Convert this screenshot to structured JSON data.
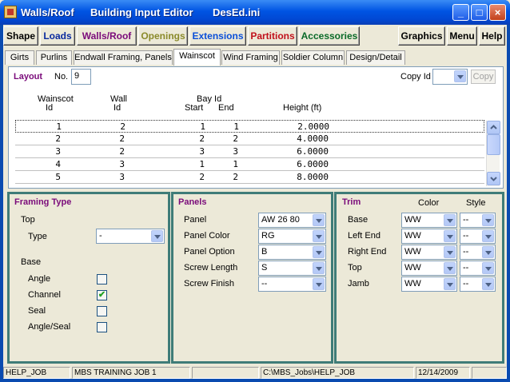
{
  "window": {
    "app_title": "Walls/Roof",
    "subtitle": "Building Input Editor",
    "file": "DesEd.ini",
    "controls": {
      "minimize": "_",
      "maximize": "□",
      "close": "×"
    }
  },
  "menu": {
    "left": [
      {
        "label": "Shape",
        "color": "#000000"
      },
      {
        "label": "Loads",
        "color": "#0a2a9e"
      },
      {
        "label": "Walls/Roof",
        "color": "#7a0a7a"
      },
      {
        "label": "Openings",
        "color": "#8a8a2a"
      },
      {
        "label": "Extensions",
        "color": "#0a4fd8"
      },
      {
        "label": "Partitions",
        "color": "#c0101a"
      },
      {
        "label": "Accessories",
        "color": "#0a6a28"
      }
    ],
    "right": [
      {
        "label": "Graphics"
      },
      {
        "label": "Menu"
      },
      {
        "label": "Help"
      }
    ]
  },
  "tabs": [
    "Girts",
    "Purlins",
    "Endwall Framing, Panels",
    "Wainscot",
    "Wind Framing",
    "Soldier Column",
    "Design/Detail"
  ],
  "active_tab": "Wainscot",
  "layout": {
    "title": "Layout",
    "no_label": "No.",
    "no_value": "9",
    "copy_id_label": "Copy Id",
    "copy_id_value": "",
    "copy_button": "Copy",
    "headers": {
      "wainscot": [
        "Wainscot",
        "Id"
      ],
      "wall": [
        "Wall",
        "Id"
      ],
      "bay": "Bay Id",
      "start": "Start",
      "end": "End",
      "height": "Height (ft)"
    },
    "rows": [
      {
        "id": "1",
        "wall": "2",
        "start": "1",
        "end": "1",
        "height": "2.0000"
      },
      {
        "id": "2",
        "wall": "2",
        "start": "2",
        "end": "2",
        "height": "4.0000"
      },
      {
        "id": "3",
        "wall": "2",
        "start": "3",
        "end": "3",
        "height": "6.0000"
      },
      {
        "id": "4",
        "wall": "3",
        "start": "1",
        "end": "1",
        "height": "6.0000"
      },
      {
        "id": "5",
        "wall": "3",
        "start": "2",
        "end": "2",
        "height": "8.0000"
      }
    ]
  },
  "framing": {
    "title": "Framing Type",
    "top_label": "Top",
    "type_label": "Type",
    "type_value": "-",
    "base_label": "Base",
    "options": [
      {
        "label": "Angle",
        "checked": false
      },
      {
        "label": "Channel",
        "checked": true
      },
      {
        "label": "Seal",
        "checked": false
      },
      {
        "label": "Angle/Seal",
        "checked": false
      }
    ],
    "check_glyph": "✔"
  },
  "panels": {
    "title": "Panels",
    "fields": [
      {
        "label": "Panel",
        "value": "AW 26 80"
      },
      {
        "label": "Panel Color",
        "value": "RG"
      },
      {
        "label": "Panel Option",
        "value": "B"
      },
      {
        "label": "Screw Length",
        "value": "S"
      },
      {
        "label": "Screw Finish",
        "value": "--"
      }
    ]
  },
  "trim": {
    "title": "Trim",
    "color_header": "Color",
    "style_header": "Style",
    "rows": [
      {
        "label": "Base",
        "color": "WW",
        "style": "--"
      },
      {
        "label": "Left End",
        "color": "WW",
        "style": "--"
      },
      {
        "label": "Right End",
        "color": "WW",
        "style": "--"
      },
      {
        "label": "Top",
        "color": "WW",
        "style": "--"
      },
      {
        "label": "Jamb",
        "color": "WW",
        "style": "--"
      }
    ]
  },
  "status": [
    "HELP_JOB",
    "MBS TRAINING JOB 1",
    "",
    "C:\\MBS_Jobs\\HELP_JOB",
    "12/14/2009",
    ""
  ],
  "colors": {
    "titlebar": "#0054e3",
    "group_border": "#3f7c78",
    "section_title": "#7a0a7a"
  }
}
